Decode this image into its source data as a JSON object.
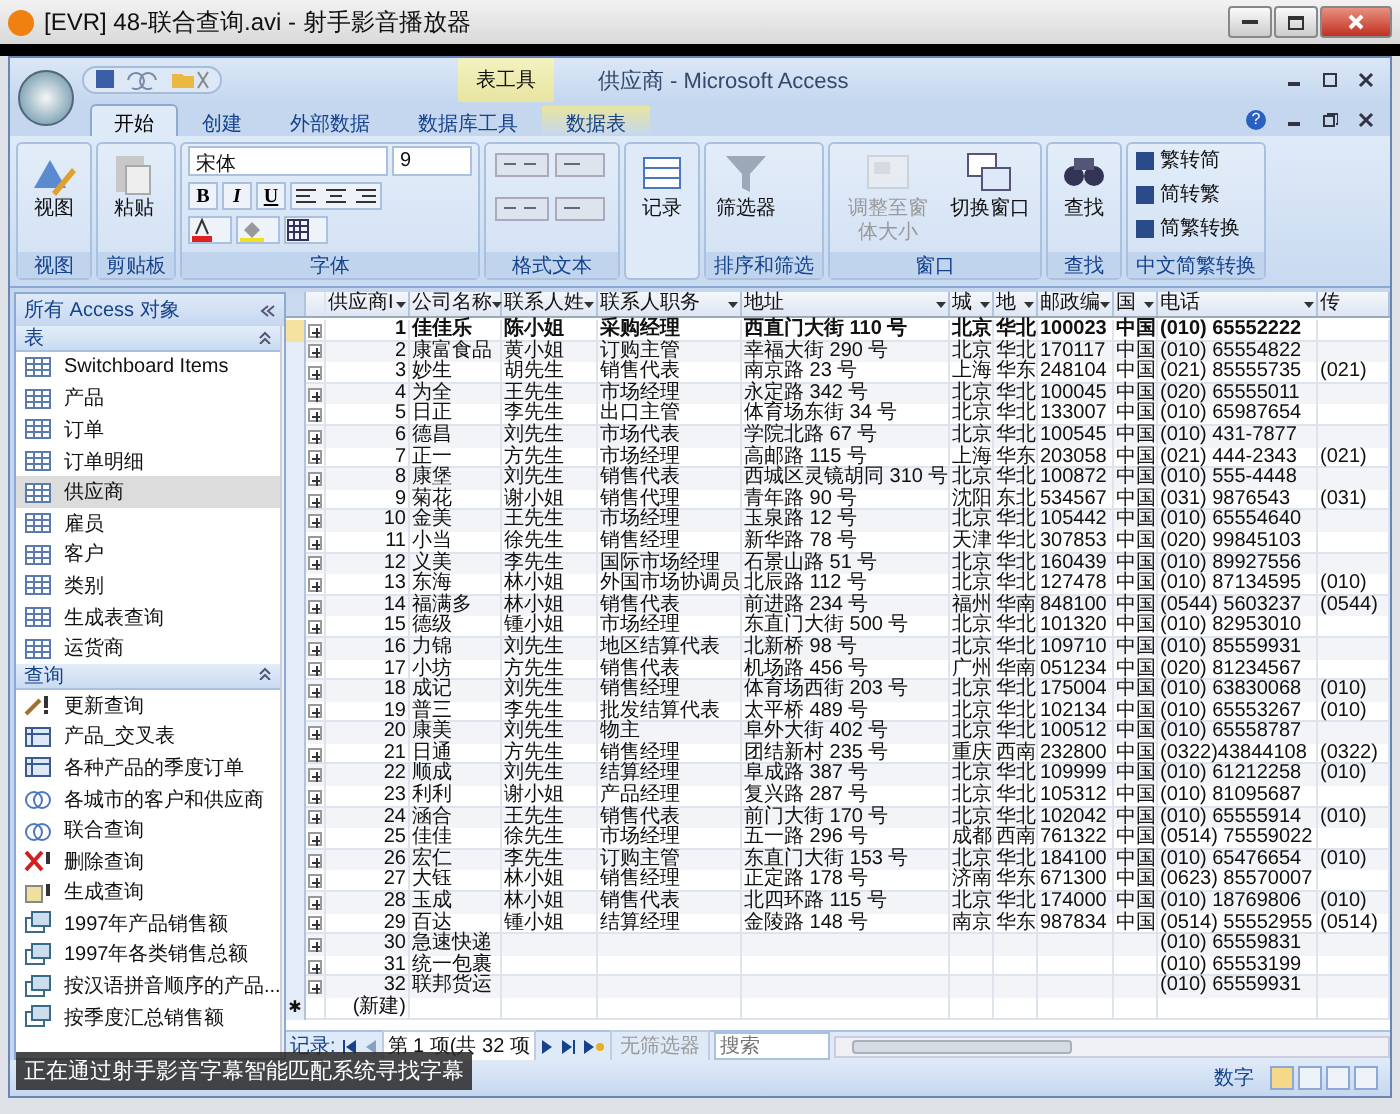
{
  "player": {
    "title": "[EVR] 48-联合查询.avi - 射手影音播放器"
  },
  "access": {
    "title": "供应商 - Microsoft Access",
    "context_tab": "表工具",
    "help": "?"
  },
  "ribbon_tabs": [
    {
      "label": "开始",
      "selected": true
    },
    {
      "label": "创建",
      "selected": false
    },
    {
      "label": "外部数据",
      "selected": false
    },
    {
      "label": "数据库工具",
      "selected": false
    },
    {
      "label": "数据表",
      "selected": false
    }
  ],
  "ribbon_groups": [
    {
      "label": "视图",
      "controls": [
        {
          "kind": "large",
          "label": "视图",
          "disabled": false
        }
      ]
    },
    {
      "label": "剪贴板",
      "controls": [
        {
          "kind": "large",
          "label": "粘贴",
          "disabled": false
        }
      ]
    },
    {
      "label": "字体",
      "font": {
        "name": "宋体",
        "size": "9"
      },
      "format_buttons": [
        "B",
        "I",
        "U"
      ]
    },
    {
      "label": "格式文本"
    },
    {
      "controls": [
        {
          "kind": "large",
          "label": "记录",
          "disabled": false
        }
      ]
    },
    {
      "label": "排序和筛选",
      "controls": [
        {
          "kind": "large",
          "label": "筛选器",
          "disabled": false
        }
      ]
    },
    {
      "label": "窗口",
      "controls": [
        {
          "kind": "large",
          "label": "调整至窗体大小",
          "disabled": true
        },
        {
          "kind": "large",
          "label": "切换窗口",
          "disabled": false
        }
      ]
    },
    {
      "label": "查找",
      "controls": [
        {
          "kind": "large",
          "label": "查找",
          "disabled": false
        }
      ]
    },
    {
      "label": "中文简繁转换",
      "controls": [
        {
          "kind": "small",
          "label": "繁转简",
          "disabled": false
        },
        {
          "kind": "small",
          "label": "简转繁",
          "disabled": false
        },
        {
          "kind": "small",
          "label": "简繁转换",
          "disabled": false
        }
      ]
    }
  ],
  "nav": {
    "header": "所有 Access 对象",
    "sections": [
      {
        "label": "表",
        "items": [
          {
            "label": "Switchboard Items",
            "kind": "table",
            "selected": false
          },
          {
            "label": "产品",
            "kind": "table",
            "selected": false
          },
          {
            "label": "订单",
            "kind": "table",
            "selected": false
          },
          {
            "label": "订单明细",
            "kind": "table",
            "selected": false
          },
          {
            "label": "供应商",
            "kind": "table",
            "selected": true
          },
          {
            "label": "雇员",
            "kind": "table",
            "selected": false
          },
          {
            "label": "客户",
            "kind": "table",
            "selected": false
          },
          {
            "label": "类别",
            "kind": "table",
            "selected": false
          },
          {
            "label": "生成表查询",
            "kind": "table",
            "selected": false
          },
          {
            "label": "运货商",
            "kind": "table",
            "selected": false
          }
        ]
      },
      {
        "label": "查询",
        "items": [
          {
            "label": "更新查询",
            "kind": "update",
            "selected": false
          },
          {
            "label": "产品_交叉表",
            "kind": "crosstab",
            "selected": false
          },
          {
            "label": "各种产品的季度订单",
            "kind": "crosstab",
            "selected": false
          },
          {
            "label": "各城市的客户和供应商",
            "kind": "union",
            "selected": false
          },
          {
            "label": "联合查询",
            "kind": "union",
            "selected": false
          },
          {
            "label": "删除查询",
            "kind": "delete",
            "selected": false
          },
          {
            "label": "生成查询",
            "kind": "maketable",
            "selected": false
          },
          {
            "label": "1997年产品销售额",
            "kind": "select",
            "selected": false
          },
          {
            "label": "1997年各类销售总额",
            "kind": "select",
            "selected": false
          },
          {
            "label": "按汉语拼音顺序的产品...",
            "kind": "select",
            "selected": false
          },
          {
            "label": "按季度汇总销售额",
            "kind": "select",
            "selected": false
          }
        ]
      }
    ]
  },
  "table": {
    "columns": [
      "供应商I",
      "公司名称",
      "联系人姓",
      "联系人职务",
      "地址",
      "城",
      "地",
      "邮政编",
      "国",
      "电话",
      "传"
    ],
    "rows": [
      {
        "selected": true,
        "cells": [
          "1",
          "佳佳乐",
          "陈小姐",
          "采购经理",
          "西直门大街 110 号",
          "北京",
          "华北",
          "100023",
          "中国",
          "(010) 65552222",
          null
        ]
      },
      {
        "selected": false,
        "cells": [
          "2",
          "康富食品",
          "黄小姐",
          "订购主管",
          "幸福大街 290 号",
          "北京",
          "华北",
          "170117",
          "中国",
          "(010) 65554822",
          null
        ]
      },
      {
        "selected": false,
        "cells": [
          "3",
          "妙生",
          "胡先生",
          "销售代表",
          "南京路 23 号",
          "上海",
          "华东",
          "248104",
          "中国",
          "(021) 85555735",
          "(021)"
        ]
      },
      {
        "selected": false,
        "cells": [
          "4",
          "为全",
          "王先生",
          "市场经理",
          "永定路 342 号",
          "北京",
          "华北",
          "100045",
          "中国",
          "(020) 65555011",
          null
        ]
      },
      {
        "selected": false,
        "cells": [
          "5",
          "日正",
          "李先生",
          "出口主管",
          "体育场东街 34 号",
          "北京",
          "华北",
          "133007",
          "中国",
          "(010) 65987654",
          null
        ]
      },
      {
        "selected": false,
        "cells": [
          "6",
          "德昌",
          "刘先生",
          "市场代表",
          "学院北路 67 号",
          "北京",
          "华北",
          "100545",
          "中国",
          "(010) 431-7877",
          null
        ]
      },
      {
        "selected": false,
        "cells": [
          "7",
          "正一",
          "方先生",
          "市场经理",
          "高邮路 115 号",
          "上海",
          "华东",
          "203058",
          "中国",
          "(021) 444-2343",
          "(021)"
        ]
      },
      {
        "selected": false,
        "cells": [
          "8",
          "康堡",
          "刘先生",
          "销售代表",
          "西城区灵镜胡同 310 号",
          "北京",
          "华北",
          "100872",
          "中国",
          "(010) 555-4448",
          null
        ]
      },
      {
        "selected": false,
        "cells": [
          "9",
          "菊花",
          "谢小姐",
          "销售代理",
          "青年路 90 号",
          "沈阳",
          "东北",
          "534567",
          "中国",
          "(031) 9876543",
          "(031)"
        ]
      },
      {
        "selected": false,
        "cells": [
          "10",
          "金美",
          "王先生",
          "市场经理",
          "玉泉路 12 号",
          "北京",
          "华北",
          "105442",
          "中国",
          "(010) 65554640",
          null
        ]
      },
      {
        "selected": false,
        "cells": [
          "11",
          "小当",
          "徐先生",
          "销售经理",
          "新华路 78 号",
          "天津",
          "华北",
          "307853",
          "中国",
          "(020) 99845103",
          null
        ]
      },
      {
        "selected": false,
        "cells": [
          "12",
          "义美",
          "李先生",
          "国际市场经理",
          "石景山路 51 号",
          "北京",
          "华北",
          "160439",
          "中国",
          "(010) 89927556",
          null
        ]
      },
      {
        "selected": false,
        "cells": [
          "13",
          "东海",
          "林小姐",
          "外国市场协调员",
          "北辰路 112 号",
          "北京",
          "华北",
          "127478",
          "中国",
          "(010) 87134595",
          "(010)"
        ]
      },
      {
        "selected": false,
        "cells": [
          "14",
          "福满多",
          "林小姐",
          "销售代表",
          "前进路 234 号",
          "福州",
          "华南",
          "848100",
          "中国",
          "(0544) 5603237",
          "(0544)"
        ]
      },
      {
        "selected": false,
        "cells": [
          "15",
          "德级",
          "锺小姐",
          "市场经理",
          "东直门大街 500 号",
          "北京",
          "华北",
          "101320",
          "中国",
          "(010) 82953010",
          null
        ]
      },
      {
        "selected": false,
        "cells": [
          "16",
          "力锦",
          "刘先生",
          "地区结算代表",
          "北新桥 98 号",
          "北京",
          "华北",
          "109710",
          "中国",
          "(010) 85559931",
          null
        ]
      },
      {
        "selected": false,
        "cells": [
          "17",
          "小坊",
          "方先生",
          "销售代表",
          "机场路 456 号",
          "广州",
          "华南",
          "051234",
          "中国",
          "(020) 81234567",
          null
        ]
      },
      {
        "selected": false,
        "cells": [
          "18",
          "成记",
          "刘先生",
          "销售经理",
          "体育场西街 203 号",
          "北京",
          "华北",
          "175004",
          "中国",
          "(010) 63830068",
          "(010)"
        ]
      },
      {
        "selected": false,
        "cells": [
          "19",
          "普三",
          "李先生",
          "批发结算代表",
          "太平桥 489 号",
          "北京",
          "华北",
          "102134",
          "中国",
          "(010) 65553267",
          "(010)"
        ]
      },
      {
        "selected": false,
        "cells": [
          "20",
          "康美",
          "刘先生",
          "物主",
          "阜外大街 402 号",
          "北京",
          "华北",
          "100512",
          "中国",
          "(010) 65558787",
          null
        ]
      },
      {
        "selected": false,
        "cells": [
          "21",
          "日通",
          "方先生",
          "销售经理",
          "团结新村 235 号",
          "重庆",
          "西南",
          "232800",
          "中国",
          "(0322)43844108",
          "(0322)"
        ]
      },
      {
        "selected": false,
        "cells": [
          "22",
          "顺成",
          "刘先生",
          "结算经理",
          "阜成路 387 号",
          "北京",
          "华北",
          "109999",
          "中国",
          "(010) 61212258",
          "(010)"
        ]
      },
      {
        "selected": false,
        "cells": [
          "23",
          "利利",
          "谢小姐",
          "产品经理",
          "复兴路 287 号",
          "北京",
          "华北",
          "105312",
          "中国",
          "(010) 81095687",
          null
        ]
      },
      {
        "selected": false,
        "cells": [
          "24",
          "涵合",
          "王先生",
          "销售代表",
          "前门大街 170 号",
          "北京",
          "华北",
          "102042",
          "中国",
          "(010) 65555914",
          "(010)"
        ]
      },
      {
        "selected": false,
        "cells": [
          "25",
          "佳佳",
          "徐先生",
          "市场经理",
          "五一路 296 号",
          "成都",
          "西南",
          "761322",
          "中国",
          "(0514) 75559022",
          null
        ]
      },
      {
        "selected": false,
        "cells": [
          "26",
          "宏仁",
          "李先生",
          "订购主管",
          "东直门大街 153 号",
          "北京",
          "华北",
          "184100",
          "中国",
          "(010) 65476654",
          "(010)"
        ]
      },
      {
        "selected": false,
        "cells": [
          "27",
          "大钰",
          "林小姐",
          "销售经理",
          "正定路 178 号",
          "济南",
          "华东",
          "671300",
          "中国",
          "(0623) 85570007",
          null
        ]
      },
      {
        "selected": false,
        "cells": [
          "28",
          "玉成",
          "林小姐",
          "销售代表",
          "北四环路 115 号",
          "北京",
          "华北",
          "174000",
          "中国",
          "(010) 18769806",
          "(010)"
        ]
      },
      {
        "selected": false,
        "cells": [
          "29",
          "百达",
          "锺小姐",
          "结算经理",
          "金陵路 148 号",
          "南京",
          "华东",
          "987834",
          "中国",
          "(0514) 55552955",
          "(0514)"
        ]
      },
      {
        "selected": false,
        "cells": [
          "30",
          "急速快递",
          null,
          null,
          null,
          null,
          null,
          null,
          null,
          "(010) 65559831",
          null
        ]
      },
      {
        "selected": false,
        "cells": [
          "31",
          "统一包裹",
          null,
          null,
          null,
          null,
          null,
          null,
          null,
          "(010) 65553199",
          null
        ]
      },
      {
        "selected": false,
        "cells": [
          "32",
          "联邦货运",
          null,
          null,
          null,
          null,
          null,
          null,
          null,
          "(010) 65559931",
          null
        ]
      }
    ],
    "new_row": {
      "marker": "✱",
      "label": "(新建)"
    }
  },
  "record_nav": {
    "label": "记录:",
    "position": "第 1 项(共 32 项",
    "filter": "无筛选器",
    "search_placeholder": "搜索"
  },
  "status_bar": {
    "mode": "数字"
  },
  "subtitle": "正在通过射手影音字幕智能匹配系统寻找字幕"
}
